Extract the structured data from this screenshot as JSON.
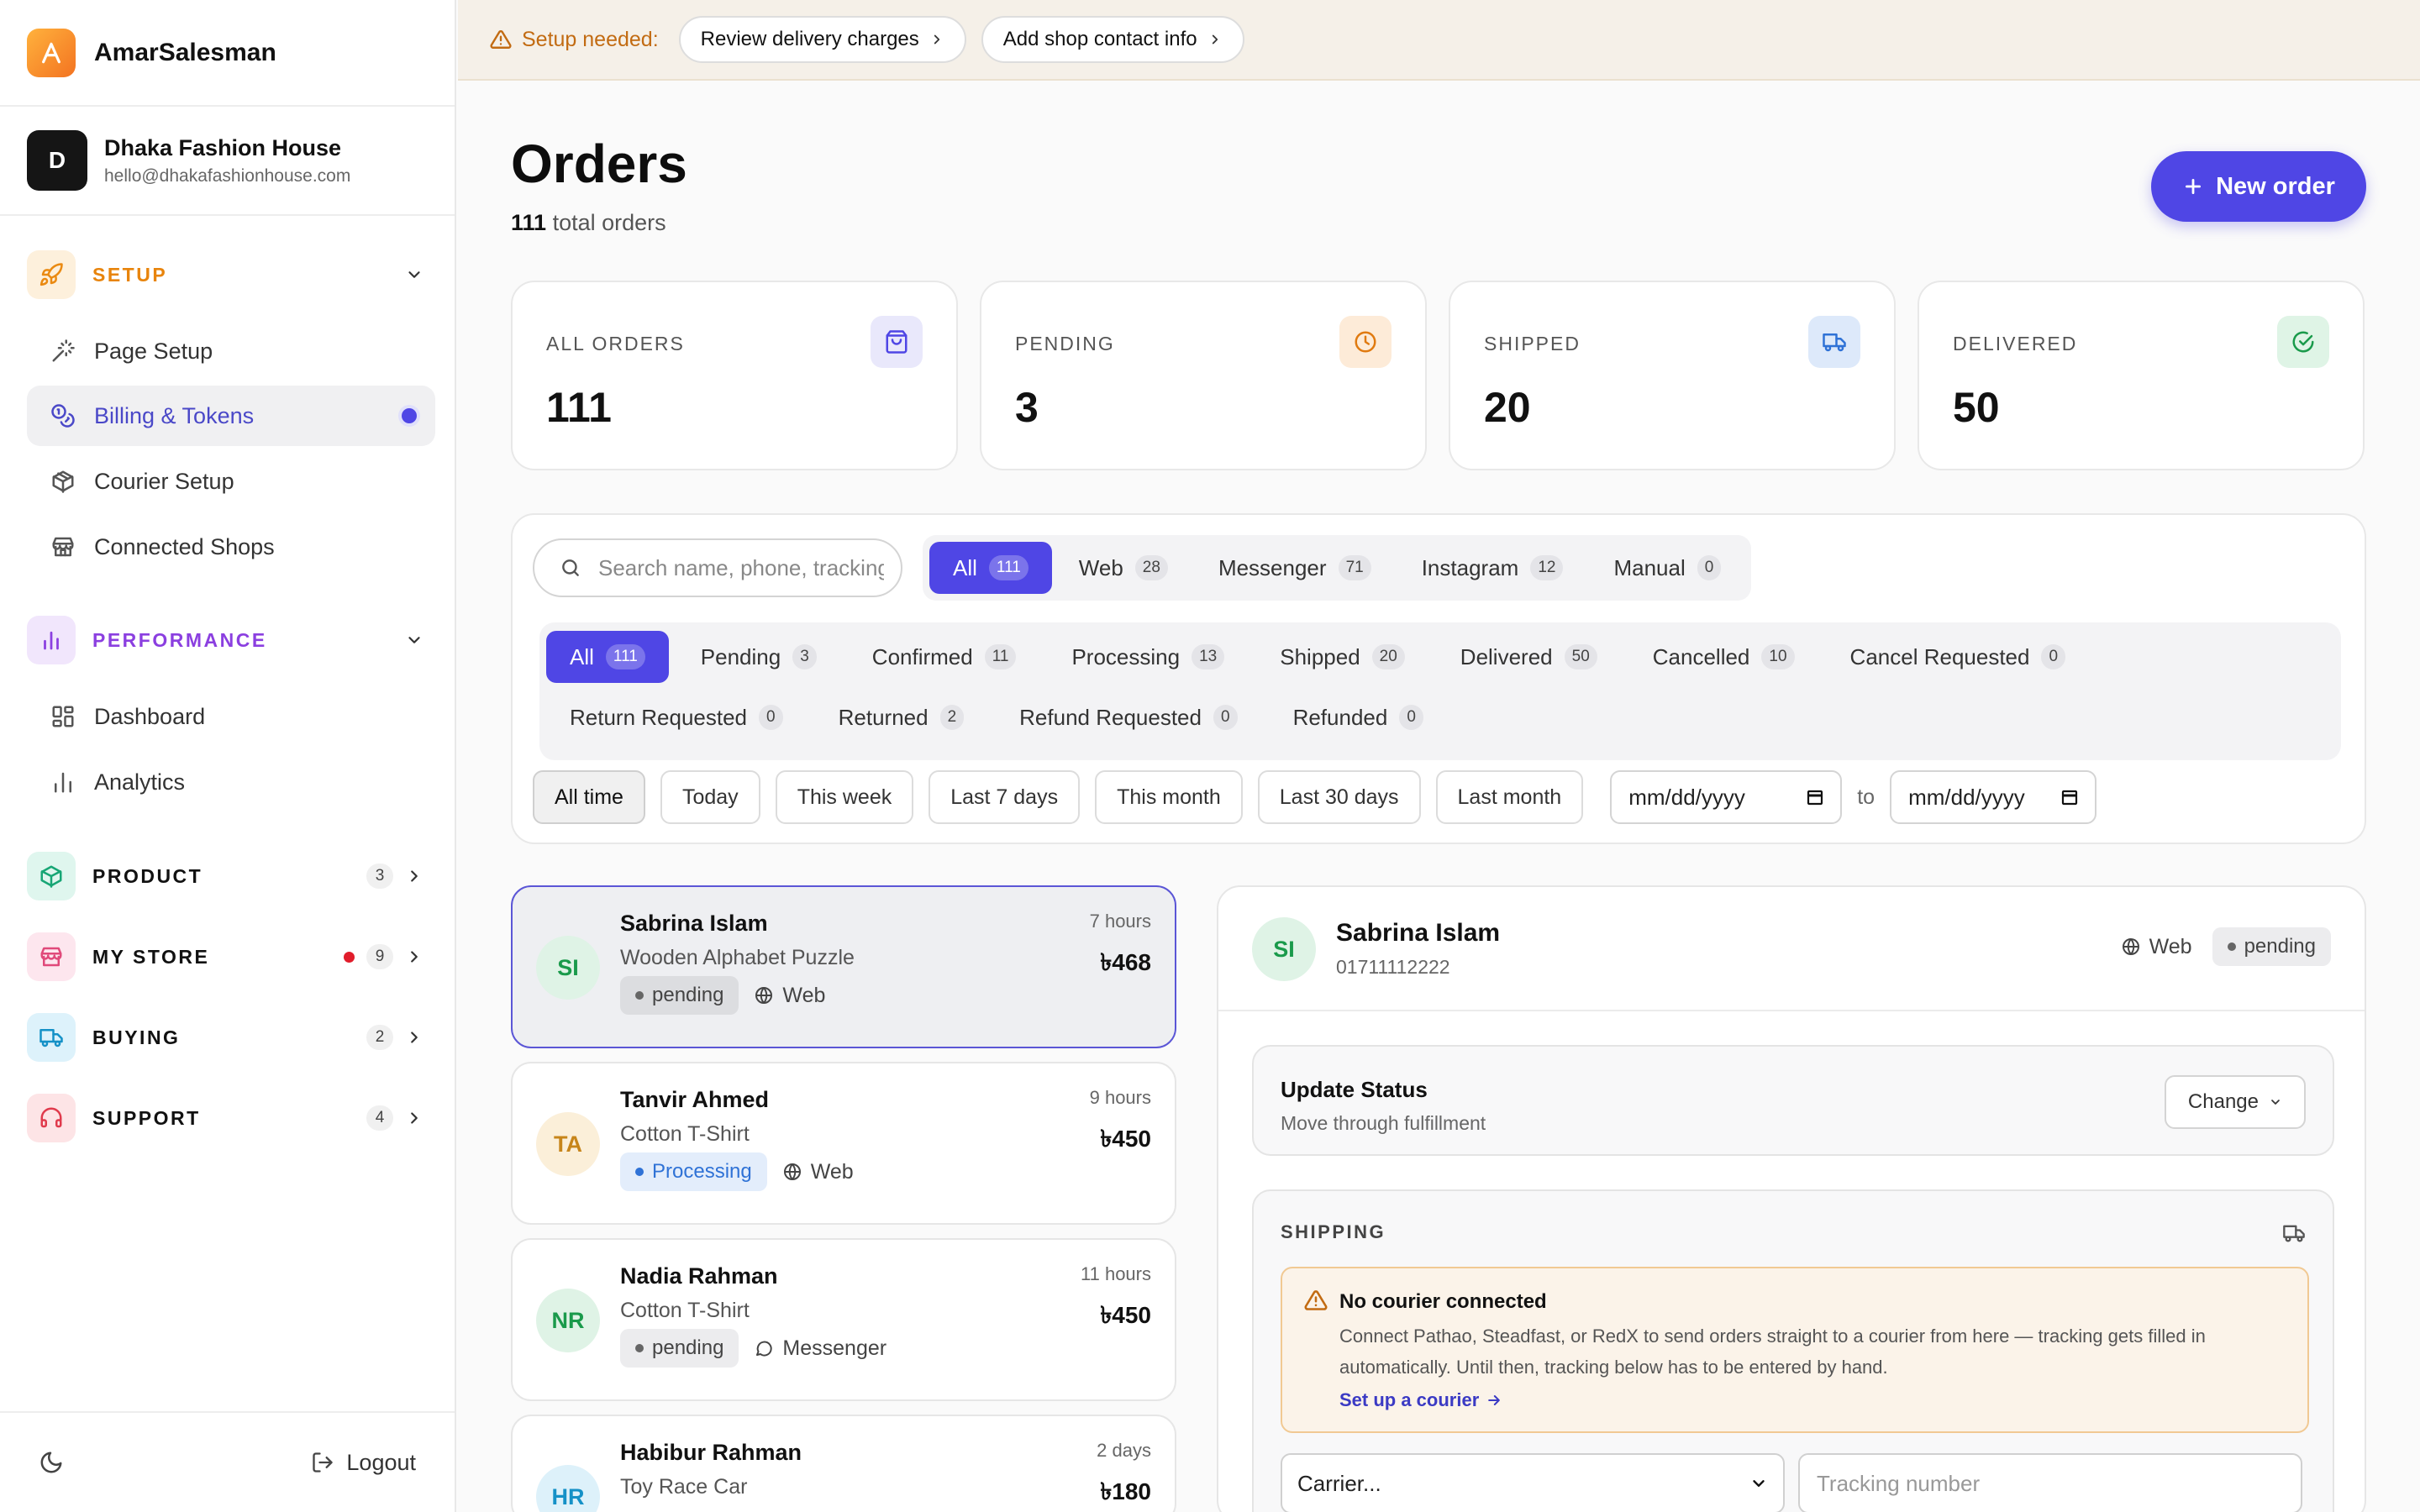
{
  "brand": {
    "name": "AmarSalesman",
    "logo_letter": "A"
  },
  "shop": {
    "avatar": "D",
    "name": "Dhaka Fashion House",
    "email": "hello@dhakafashionhouse.com"
  },
  "sidebar": {
    "setup": {
      "title": "SETUP",
      "color": "#e8840c",
      "items": [
        {
          "label": "Page Setup",
          "icon": "wand-icon"
        },
        {
          "label": "Billing & Tokens",
          "icon": "coins-icon",
          "active": true
        },
        {
          "label": "Courier Setup",
          "icon": "package-icon"
        },
        {
          "label": "Connected Shops",
          "icon": "store-icon"
        }
      ]
    },
    "performance": {
      "title": "PERFORMANCE",
      "color": "#8b3fe0",
      "items": [
        {
          "label": "Dashboard",
          "icon": "grid-icon"
        },
        {
          "label": "Analytics",
          "icon": "bar-chart-icon"
        }
      ]
    },
    "product": {
      "title": "PRODUCT",
      "count": "3"
    },
    "my_store": {
      "title": "MY STORE",
      "count": "9"
    },
    "buying": {
      "title": "BUYING",
      "count": "2"
    },
    "support": {
      "title": "SUPPORT",
      "count": "4"
    },
    "logout": "Logout"
  },
  "banner": {
    "label": "Setup needed:",
    "actions": [
      "Review delivery charges",
      "Add shop contact info"
    ]
  },
  "header": {
    "title": "Orders",
    "total": "111",
    "total_suffix": "total orders",
    "new_order": "New order"
  },
  "stats": [
    {
      "label": "ALL ORDERS",
      "value": "111",
      "icon": "bag-icon"
    },
    {
      "label": "PENDING",
      "value": "3",
      "icon": "clock-icon"
    },
    {
      "label": "SHIPPED",
      "value": "20",
      "icon": "truck-icon"
    },
    {
      "label": "DELIVERED",
      "value": "50",
      "icon": "check-circle-icon"
    }
  ],
  "search": {
    "placeholder": "Search name, phone, tracking"
  },
  "channel_tabs": [
    {
      "label": "All",
      "count": "111"
    },
    {
      "label": "Web",
      "count": "28"
    },
    {
      "label": "Messenger",
      "count": "71"
    },
    {
      "label": "Instagram",
      "count": "12"
    },
    {
      "label": "Manual",
      "count": "0"
    }
  ],
  "status_tabs": [
    {
      "label": "All",
      "count": "111"
    },
    {
      "label": "Pending",
      "count": "3"
    },
    {
      "label": "Confirmed",
      "count": "11"
    },
    {
      "label": "Processing",
      "count": "13"
    },
    {
      "label": "Shipped",
      "count": "20"
    },
    {
      "label": "Delivered",
      "count": "50"
    },
    {
      "label": "Cancelled",
      "count": "10"
    },
    {
      "label": "Cancel Requested",
      "count": "0"
    },
    {
      "label": "Return Requested",
      "count": "0"
    },
    {
      "label": "Returned",
      "count": "2"
    },
    {
      "label": "Refund Requested",
      "count": "0"
    },
    {
      "label": "Refunded",
      "count": "0"
    }
  ],
  "date_filters": [
    "All time",
    "Today",
    "This week",
    "Last 7 days",
    "This month",
    "Last 30 days",
    "Last month"
  ],
  "date_range": {
    "from": "mm/dd/yyyy",
    "to_label": "to",
    "to": "mm/dd/yyyy"
  },
  "orders": [
    {
      "initials": "SI",
      "name": "Sabrina Islam",
      "product": "Wooden Alphabet Puzzle",
      "time": "7 hours",
      "price": "৳468",
      "status": "pending",
      "channel": "Web"
    },
    {
      "initials": "TA",
      "name": "Tanvir Ahmed",
      "product": "Cotton T-Shirt",
      "time": "9 hours",
      "price": "৳450",
      "status": "Processing",
      "channel": "Web"
    },
    {
      "initials": "NR",
      "name": "Nadia Rahman",
      "product": "Cotton T-Shirt",
      "time": "11 hours",
      "price": "৳450",
      "status": "pending",
      "channel": "Messenger"
    },
    {
      "initials": "HR",
      "name": "Habibur Rahman",
      "product": "Toy Race Car",
      "time": "2 days",
      "price": "৳180"
    }
  ],
  "detail": {
    "initials": "SI",
    "name": "Sabrina Islam",
    "phone": "01711112222",
    "channel": "Web",
    "status": "pending",
    "update_title": "Update Status",
    "update_sub": "Move through fulfillment",
    "change": "Change",
    "shipping_title": "SHIPPING",
    "warn_title": "No courier connected",
    "warn_body": "Connect Pathao, Steadfast, or RedX to send orders straight to a courier from here — tracking gets filled in automatically. Until then, tracking below has to be entered by hand.",
    "warn_link": "Set up a courier",
    "carrier": "Carrier...",
    "tracking_placeholder": "Tracking number"
  }
}
